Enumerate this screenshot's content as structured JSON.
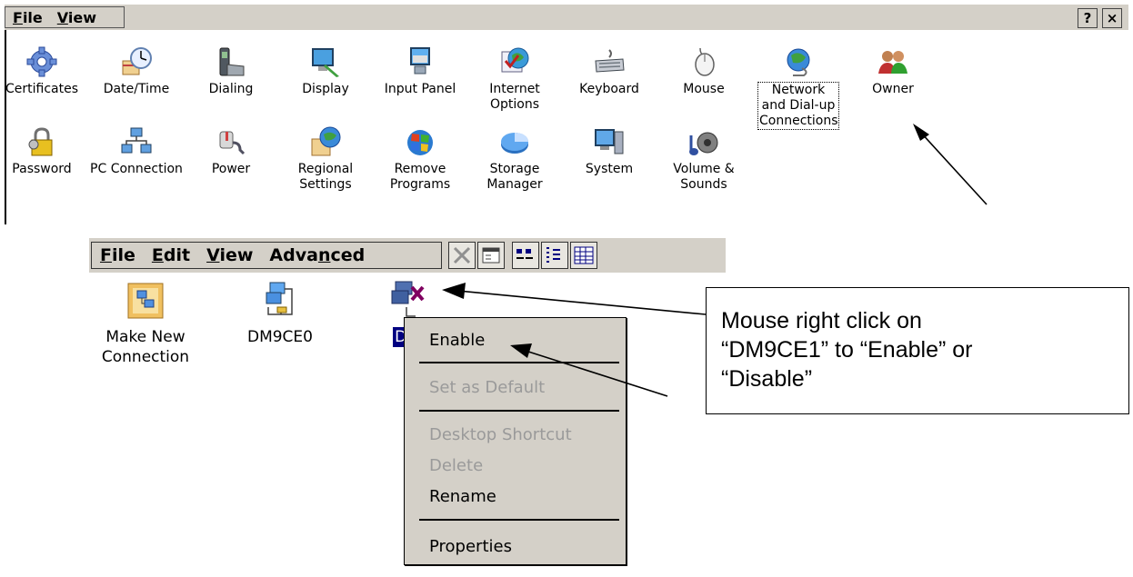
{
  "control_panel": {
    "menu": [
      {
        "label": "File",
        "accel": "F",
        "rest": "ile"
      },
      {
        "label": "View",
        "accel": "V",
        "rest": "iew"
      }
    ],
    "help_button": "?",
    "close_button": "×",
    "items": [
      {
        "label": "Certificates",
        "icon": "gear-icon"
      },
      {
        "label": "Date/Time",
        "icon": "clock-icon"
      },
      {
        "label": "Dialing",
        "icon": "phone-icon"
      },
      {
        "label": "Display",
        "icon": "monitor-icon"
      },
      {
        "label": "Input Panel",
        "icon": "keyboard-panel-icon"
      },
      {
        "label": "Internet Options",
        "icon": "globe-check-icon"
      },
      {
        "label": "Keyboard",
        "icon": "keyboard-icon"
      },
      {
        "label": "Mouse",
        "icon": "mouse-icon"
      },
      {
        "label": "Network and Dial-up Connections",
        "icon": "network-globe-icon"
      },
      {
        "label": "Owner",
        "icon": "users-icon"
      },
      {
        "label": "Password",
        "icon": "lock-icon"
      },
      {
        "label": "PC Connection",
        "icon": "pc-network-icon"
      },
      {
        "label": "Power",
        "icon": "plug-icon"
      },
      {
        "label": "Regional Settings",
        "icon": "globe-calendar-icon"
      },
      {
        "label": "Remove Programs",
        "icon": "windows-logo-icon"
      },
      {
        "label": "Storage Manager",
        "icon": "pie-icon"
      },
      {
        "label": "System",
        "icon": "computer-icon"
      },
      {
        "label": "Volume & Sounds",
        "icon": "speaker-note-icon"
      }
    ]
  },
  "network_connections": {
    "menu": [
      {
        "label": "File",
        "accel": "F",
        "rest": "ile"
      },
      {
        "label": "Edit",
        "accel": "E",
        "rest": "dit"
      },
      {
        "label": "View",
        "accel": "V",
        "rest": "iew"
      },
      {
        "pre": "Adva",
        "accel": "n",
        "rest": "ced",
        "label": "Advanced"
      }
    ],
    "items": [
      {
        "label": "Make New Connection",
        "icon": "new-connection-folder-icon"
      },
      {
        "label": "DM9CE0",
        "icon": "network-connection-icon"
      },
      {
        "label": "DM",
        "icon": "disabled-connection-icon"
      }
    ],
    "context_menu": {
      "enable": "Enable",
      "set_default": "Set as Default",
      "desktop_shortcut": "Desktop Shortcut",
      "delete": "Delete",
      "rename": "Rename",
      "properties": "Properties"
    }
  },
  "callout": {
    "line1": "Mouse right click on",
    "line2": "“DM9CE1” to  “Enable” or",
    "line3": "“Disable”"
  },
  "colors": {
    "chrome": "#d4d0c8",
    "disabled_text": "#9a9a9a",
    "selection": "#000080"
  }
}
